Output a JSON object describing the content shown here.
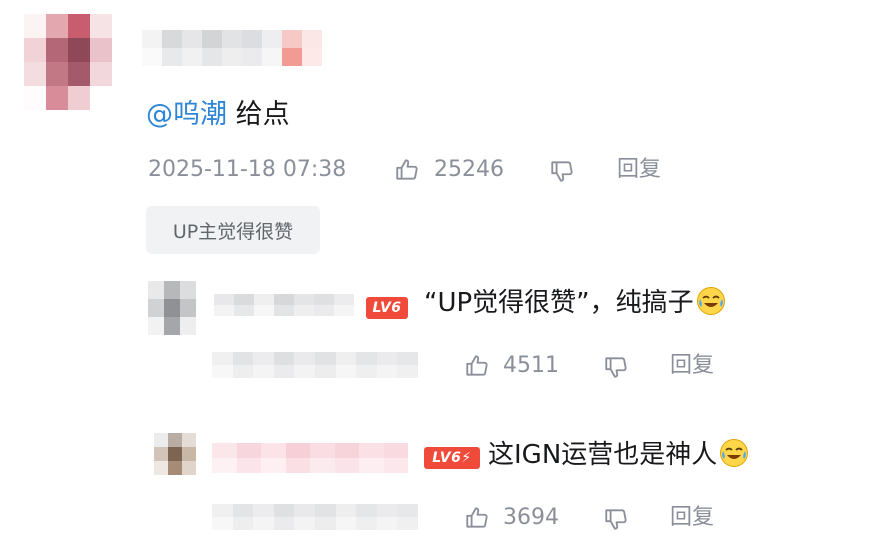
{
  "comment": {
    "mention": "@呜潮",
    "text": "给点",
    "timestamp": "2025-11-18 07:38",
    "likes": "25246",
    "reply_label": "回复",
    "up_badge": "UP主觉得很赞"
  },
  "replies": [
    {
      "level": "LV6",
      "text": "“UP觉得很赞”，纯搞子",
      "emoji": "crying-laughing-emoji",
      "likes": "4511",
      "reply_label": "回复"
    },
    {
      "level": "LV6⚡",
      "text": "这IGN运营也是神人",
      "emoji": "crying-laughing-emoji",
      "likes": "3694",
      "reply_label": "回复"
    }
  ],
  "colors": {
    "mention": "#2e87d6",
    "meta": "#8a8f99",
    "level_badge": "#ef4a3a",
    "up_badge_bg": "#f1f2f3"
  },
  "icons": [
    "thumbs-up-icon",
    "thumbs-down-icon"
  ]
}
